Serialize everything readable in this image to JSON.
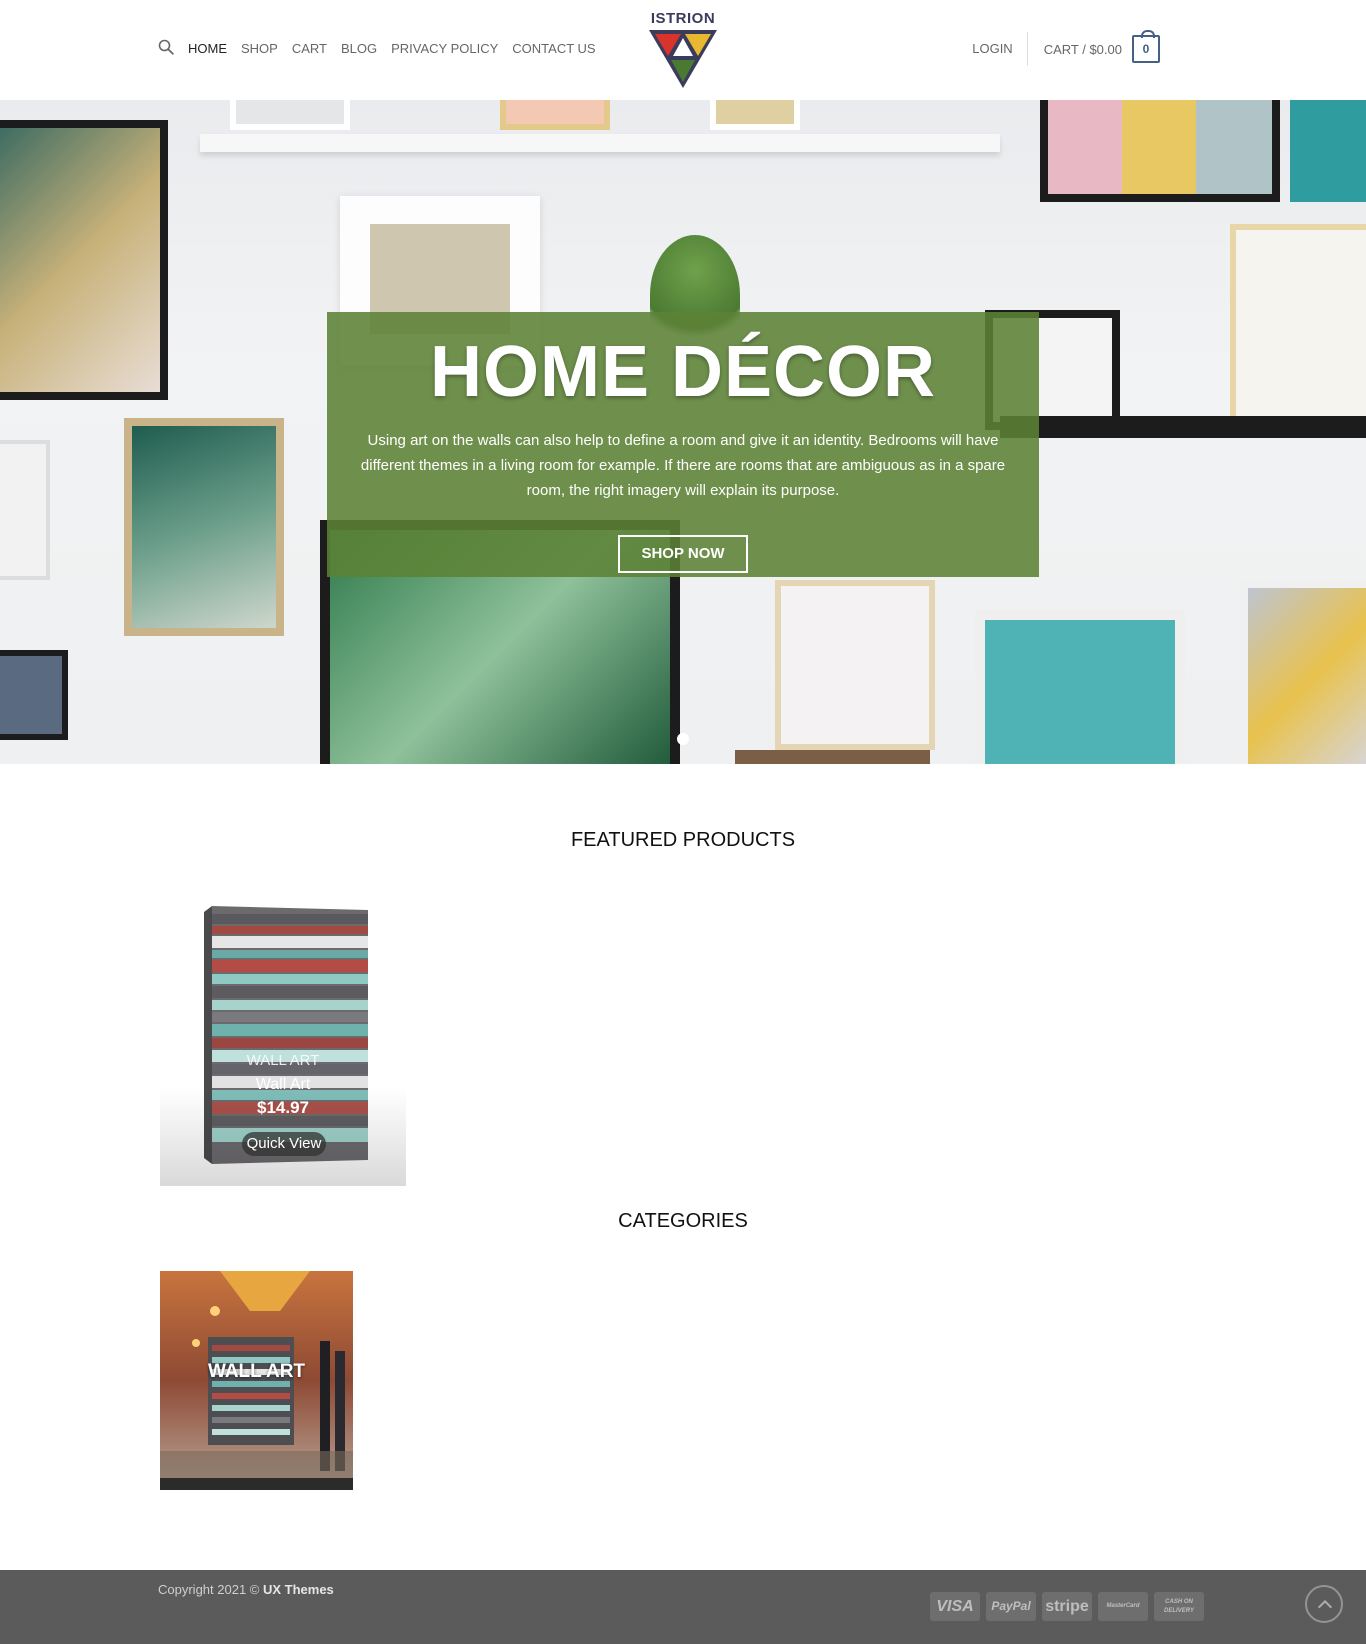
{
  "header": {
    "logo_text": "ISTRION",
    "nav": [
      {
        "label": "HOME",
        "active": true
      },
      {
        "label": "SHOP"
      },
      {
        "label": "CART"
      },
      {
        "label": "BLOG"
      },
      {
        "label": "PRIVACY POLICY"
      },
      {
        "label": "CONTACT US"
      }
    ],
    "login_label": "LOGIN",
    "cart_label": "CART / $0.00",
    "cart_count": "0"
  },
  "hero": {
    "title": "HOME DÉCOR",
    "text": "Using art on the walls can also help to define a room and give it an identity. Bedrooms will have different themes in a living room for example. If there are rooms that are ambiguous as in a spare room, the right imagery will explain its purpose.",
    "button_label": "SHOP NOW",
    "box_color": "#5c8236"
  },
  "featured": {
    "title": "FEATURED PRODUCTS",
    "products": [
      {
        "category": "WALL ART",
        "name": "Wall Art",
        "price": "$14.97",
        "quick_view_label": "Quick View"
      }
    ]
  },
  "categories": {
    "title": "CATEGORIES",
    "items": [
      {
        "label": "WALL ART"
      }
    ]
  },
  "footer": {
    "copyright_prefix": "Copyright 2021 ©",
    "copyright_brand": "UX Themes",
    "payment_icons": [
      "VISA",
      "PayPal",
      "stripe",
      "MasterCard",
      "CASH ON DELIVERY"
    ]
  },
  "colors": {
    "accent": "#446084",
    "footer_bg": "#5b5b5b"
  }
}
